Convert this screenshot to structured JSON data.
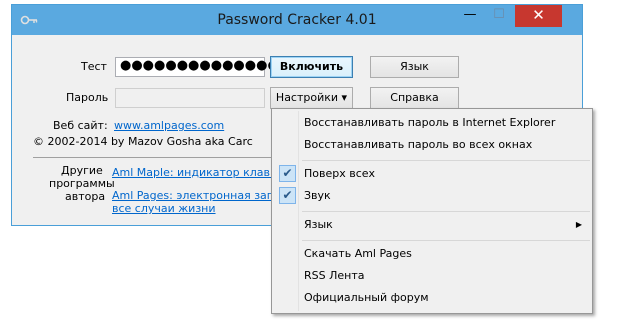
{
  "window": {
    "title": "Password Cracker 4.01",
    "controls": {
      "minimize": "—",
      "maximize": "☐",
      "close": "✕"
    },
    "icon": "key-icon"
  },
  "form": {
    "test_label": "Тест",
    "password_value": "●●●●●●●●●●●●●●●●",
    "password_label": "Пароль",
    "password_field_value": "",
    "website_label": "Веб сайт:",
    "website_link": "www.amlpages.com",
    "copyright": "© 2002-2014 by Mazov Gosha aka Carc",
    "other_programs_label_1": "Другие",
    "other_programs_label_2": "программы",
    "other_programs_label_3": "автора",
    "program_link_1": "Aml Maple: индикатор клавиатур",
    "program_link_2_line1": "Aml Pages: электронная записна",
    "program_link_2_line2": "все случаи жизни"
  },
  "buttons": {
    "enable": "Включить",
    "language": "Язык",
    "settings": "Настройки ▾",
    "help": "Справка"
  },
  "menu": {
    "items": [
      {
        "label": "Восстанавливать пароль в Internet Explorer",
        "checked": false
      },
      {
        "label": "Восстанавливать пароль во всех окнах",
        "checked": false
      },
      {
        "label": "Поверх всех",
        "checked": true
      },
      {
        "label": "Звук",
        "checked": true
      },
      {
        "label": "Язык",
        "checked": false,
        "submenu": true
      },
      {
        "label": "Скачать Aml Pages",
        "checked": false
      },
      {
        "label": "RSS Лента",
        "checked": false
      },
      {
        "label": "Официальный форум",
        "checked": false
      }
    ],
    "check_glyph": "✔",
    "submenu_glyph": "▶"
  },
  "colors": {
    "titlebar": "#5aa9e0",
    "close_button": "#c7372f",
    "link": "#0066cc"
  }
}
